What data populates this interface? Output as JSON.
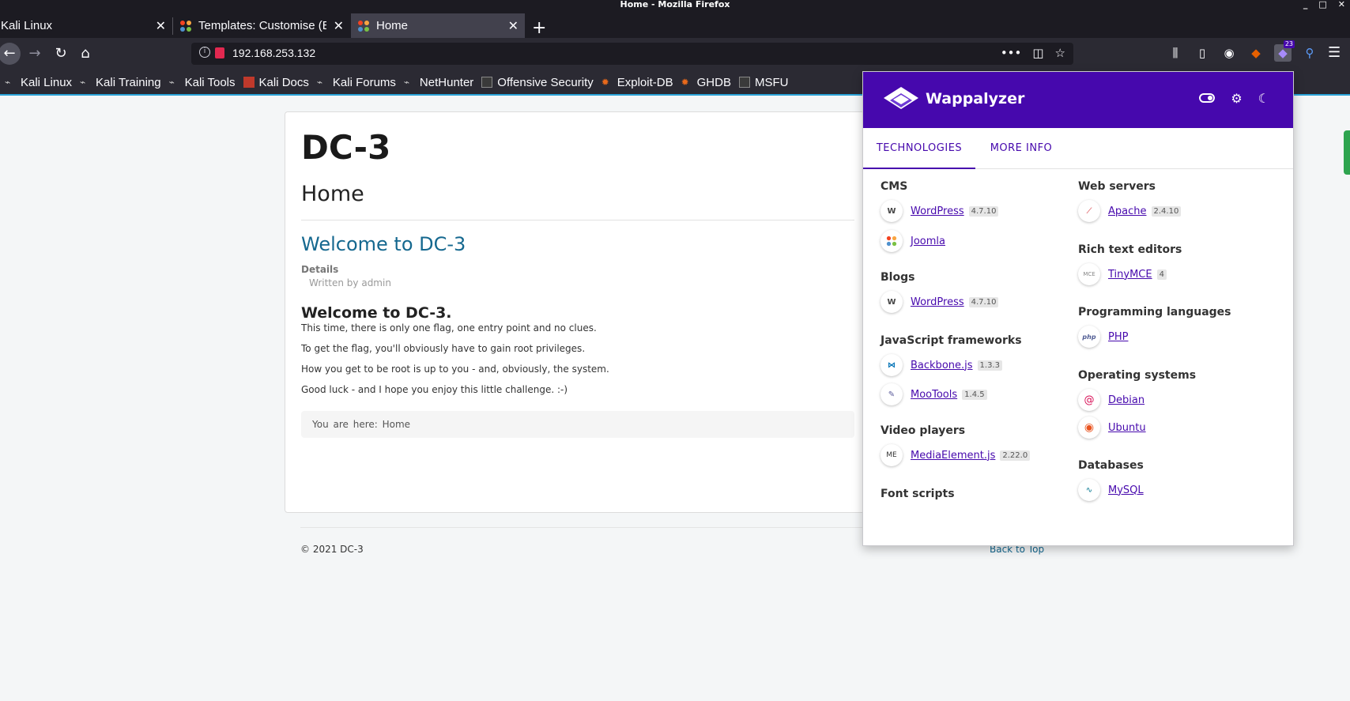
{
  "window": {
    "title": "Home - Mozilla Firefox"
  },
  "tabs": [
    {
      "label": "Kali Linux"
    },
    {
      "label": "Templates: Customise (B"
    },
    {
      "label": "Home"
    }
  ],
  "urlbar": {
    "url": "192.168.253.132",
    "info_glyph": "i"
  },
  "toolbar_badge": "23",
  "bookmarks": [
    {
      "label": "Kali Linux"
    },
    {
      "label": "Kali Training"
    },
    {
      "label": "Kali Tools"
    },
    {
      "label": "Kali Docs"
    },
    {
      "label": "Kali Forums"
    },
    {
      "label": "NetHunter"
    },
    {
      "label": "Offensive Security"
    },
    {
      "label": "Exploit-DB"
    },
    {
      "label": "GHDB"
    },
    {
      "label": "MSFU"
    }
  ],
  "site": {
    "title": "DC-3",
    "page_heading": "Home",
    "article_title": "Welcome to DC-3",
    "details_label": "Details",
    "written_by": "Written by admin",
    "intro_heading": "Welcome to DC-3.",
    "paragraphs": [
      "This time, there is only one flag, one entry point and no clues.",
      "To get the flag, you'll obviously have to gain root privileges.",
      "How you get to be root is up to you - and, obviously, the system.",
      "Good luck - and I hope you enjoy this little challenge.  :-)"
    ],
    "breadcrumb": "You are here:   Home",
    "copyright": "© 2021 DC-3",
    "back_to_top": "Back to Top"
  },
  "wappalyzer": {
    "name": "Wappalyzer",
    "tabs": [
      "TECHNOLOGIES",
      "MORE INFO"
    ],
    "left": {
      "cms": {
        "label": "CMS",
        "wordpress": "WordPress",
        "wordpress_ver": "4.7.10",
        "joomla": "Joomla"
      },
      "blogs": {
        "label": "Blogs",
        "wordpress": "WordPress",
        "wordpress_ver": "4.7.10"
      },
      "js": {
        "label": "JavaScript frameworks",
        "backbone": "Backbone.js",
        "backbone_ver": "1.3.3",
        "mootools": "MooTools",
        "mootools_ver": "1.4.5"
      },
      "video": {
        "label": "Video players",
        "mediaelement": "MediaElement.js",
        "mediaelement_ver": "2.22.0"
      },
      "font": {
        "label": "Font scripts"
      }
    },
    "right": {
      "web": {
        "label": "Web servers",
        "apache": "Apache",
        "apache_ver": "2.4.10"
      },
      "rte": {
        "label": "Rich text editors",
        "tinymce": "TinyMCE",
        "tinymce_ver": "4"
      },
      "lang": {
        "label": "Programming languages",
        "php": "PHP"
      },
      "os": {
        "label": "Operating systems",
        "debian": "Debian",
        "ubuntu": "Ubuntu"
      },
      "db": {
        "label": "Databases",
        "mysql": "MySQL"
      }
    }
  },
  "colors": {
    "wappalyzer_purple": "#4608ad",
    "joomla_link": "#15688f",
    "tab_active": "#42414d"
  }
}
